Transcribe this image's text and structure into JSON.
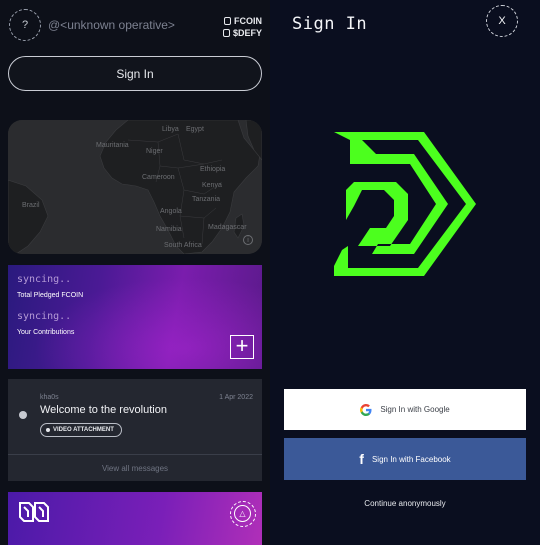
{
  "left": {
    "avatar_glyph": "?",
    "operative_label": "@<unknown operative>",
    "coins": [
      {
        "label": "FCOIN"
      },
      {
        "label": "$DEFY"
      }
    ],
    "sign_in_label": "Sign In",
    "map": {
      "labels": [
        "Libya",
        "Egypt",
        "Mauritania",
        "Niger",
        "Cameroon",
        "Ethiopia",
        "Kenya",
        "Brazil",
        "Angola",
        "Tanzania",
        "Namibia",
        "Madagascar",
        "South Africa"
      ],
      "info_glyph": "i"
    },
    "pledge_card": {
      "sync_text_1": "syncing..",
      "label_1": "Total Pledged FCOIN",
      "sync_text_2": "syncing..",
      "label_2": "Your Contributions",
      "add_glyph": "+"
    },
    "message": {
      "author": "kha0s",
      "date": "1 Apr 2022",
      "title": "Welcome to the revolution",
      "attachment_label": "VIDEO ATTACHMENT",
      "view_all_label": "View all messages"
    },
    "promo": {
      "button_glyph": "△"
    }
  },
  "right": {
    "title": "Sign In",
    "close_label": "X",
    "google_label": "Sign In with Google",
    "facebook_label": "Sign In with Facebook",
    "facebook_glyph": "f",
    "anonymous_label": "Continue anonymously",
    "colors": {
      "brand_green": "#4cff1e",
      "facebook_blue": "#3b5998",
      "background": "#0a0e1f"
    }
  }
}
